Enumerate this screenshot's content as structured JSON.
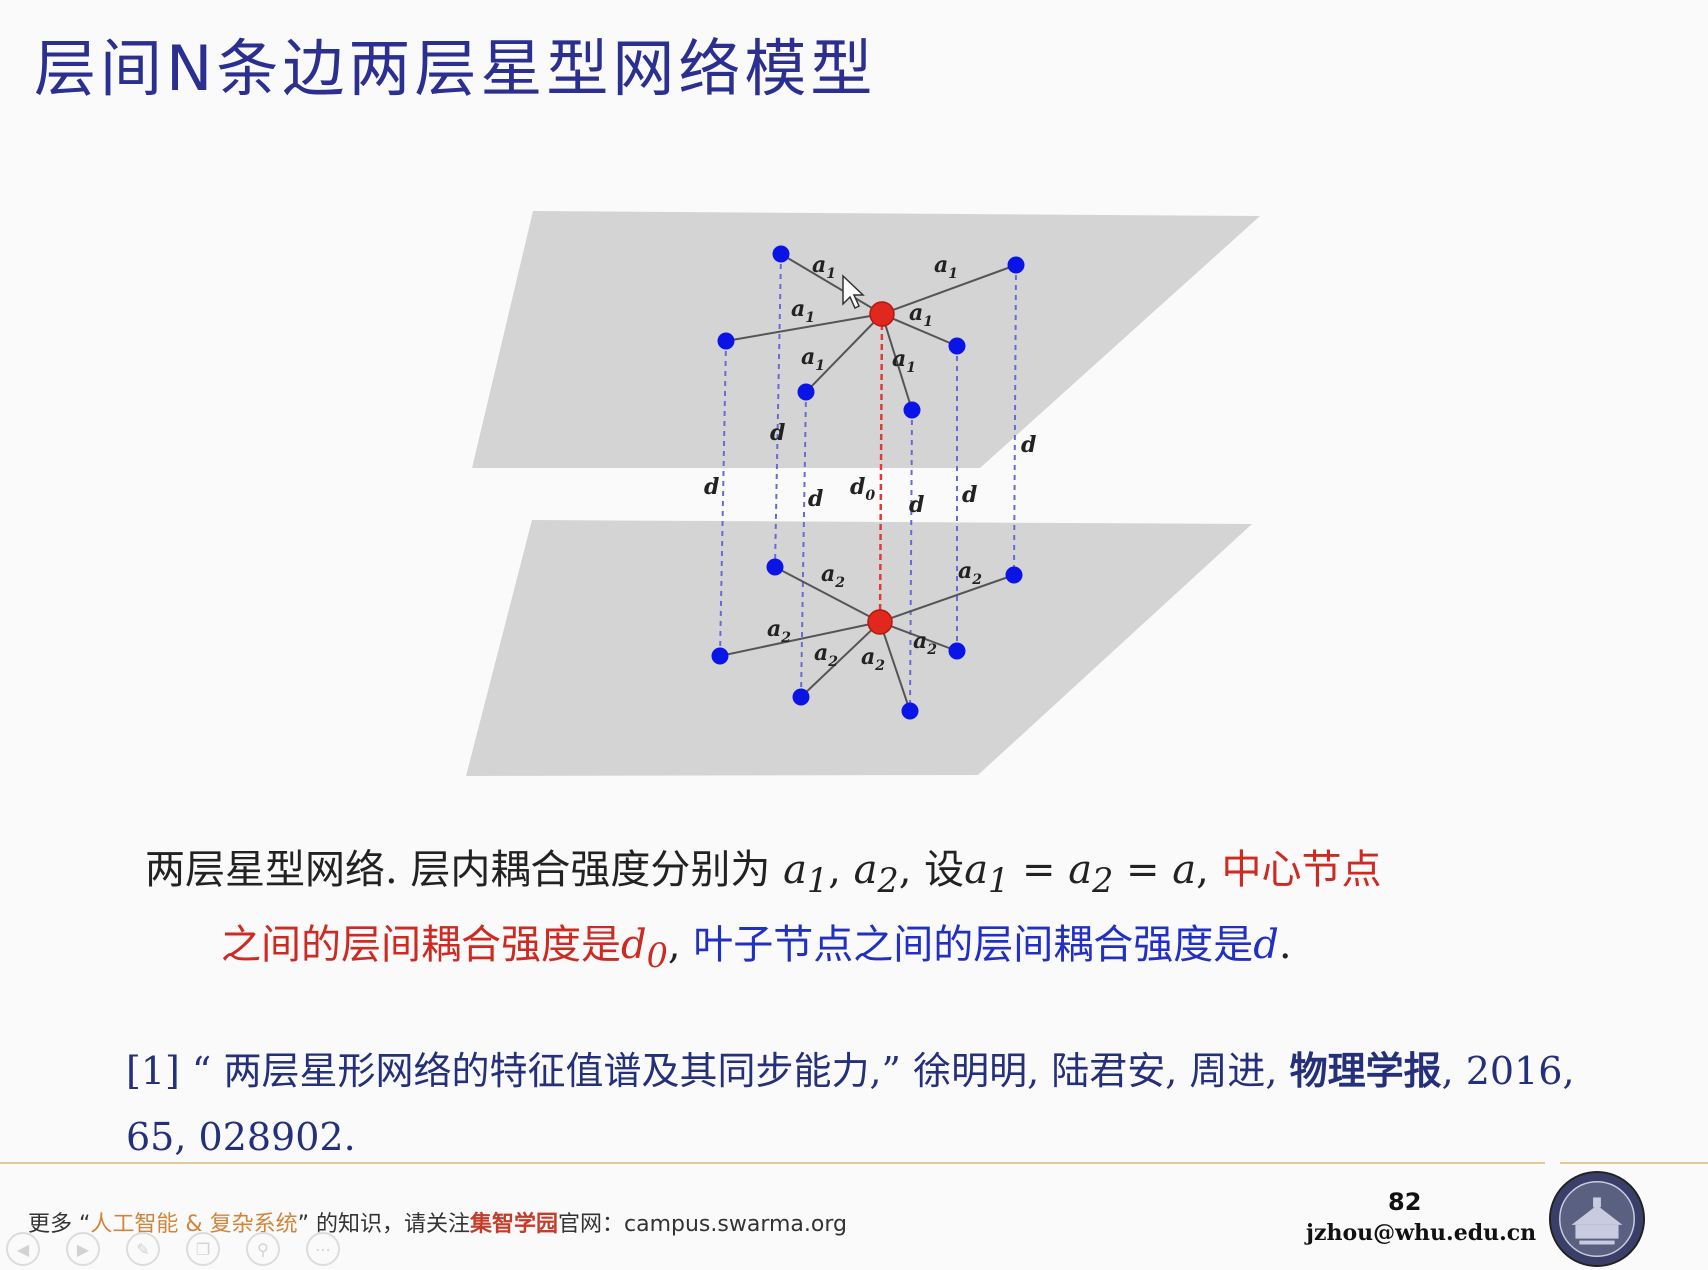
{
  "slide": {
    "title": "层间N条边两层星型网络模型",
    "page_number": "82",
    "email": "jzhou@whu.edu.cn"
  },
  "figure": {
    "upper_labels": {
      "a1": "a",
      "a1_sub": "1"
    },
    "lower_labels": {
      "a2": "a",
      "a2_sub": "2"
    },
    "interlayer_label": "d",
    "center_interlayer_label": "d",
    "center_interlayer_sub": "0",
    "colors": {
      "plane": "#d4d4d4",
      "hub": "#e0281e",
      "leaf": "#0a14e6",
      "leaf_link": "#6a6ad6",
      "hub_link": "#e03a3a",
      "edge": "#555555"
    }
  },
  "caption": {
    "line1_part1": "两层星型网络. 层内耦合强度分别为 ",
    "a1": "a",
    "a1_sub": "1",
    "comma1": ", ",
    "a2": "a",
    "a2_sub": "2",
    "set_text": ", 设",
    "eq_a1": "a",
    "eq_a1_sub": "1",
    "eq1": " = ",
    "eq_a2": "a",
    "eq_a2_sub": "2",
    "eq2": " = ",
    "eq_a": "a",
    "comma2": ", ",
    "red_part1": "中心节点",
    "red_part2": "之间的层间耦合强度是",
    "d0": "d",
    "d0_sub": "0",
    "comma3": ", ",
    "blue_part": "叶子节点之间的层间耦合强度是",
    "d": "d",
    "period": "."
  },
  "reference": {
    "number": "[1]",
    "open_quote": "“",
    "paper_title": "两层星形网络的特征值谱及其同步能力,",
    "close_quote": "”",
    "authors": "徐明明, 陆君安, 周进, ",
    "journal": "物理学报",
    "details": ", 2016, 65, 028902."
  },
  "footer": {
    "prefix": "更多",
    "quote_open": "“",
    "topic": "人工智能 & 复杂系统",
    "quote_close": "”",
    "mid": "的知识，请关注",
    "brand": "集智学园",
    "suffix": "官网：campus.swarma.org"
  },
  "nav_icons": [
    "prev-icon",
    "next-icon",
    "pen-icon",
    "copy-icon",
    "zoom-icon",
    "more-icon"
  ]
}
